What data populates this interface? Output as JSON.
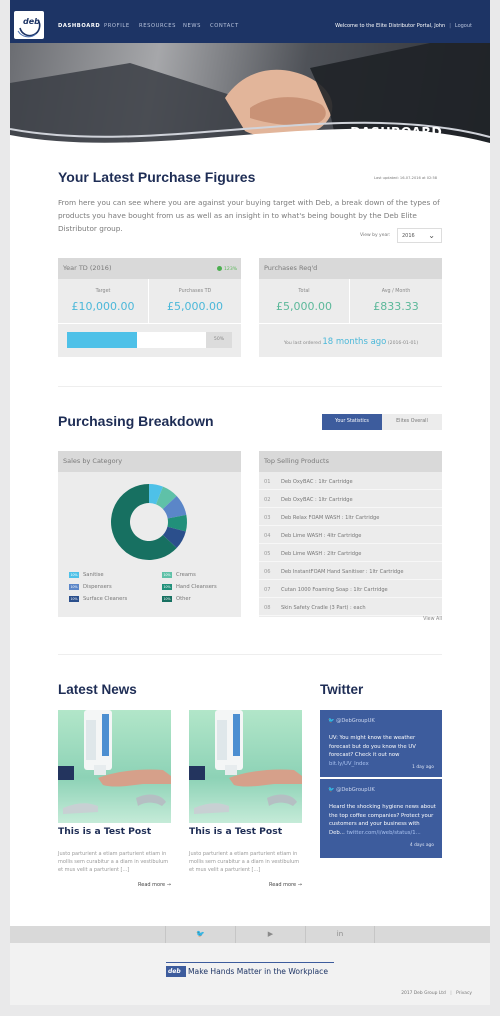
{
  "nav": {
    "logo_text": "deb",
    "items": [
      {
        "label": "DASHBOARD"
      },
      {
        "label": "PROFILE"
      },
      {
        "label": "RESOURCES"
      },
      {
        "label": "NEWS"
      },
      {
        "label": "CONTACT"
      }
    ],
    "welcome": "Welcome to the Elite Distributor Portal, John",
    "separator": "|",
    "logout": "Logout"
  },
  "hero": {
    "title": "DASHBOARD"
  },
  "purchase": {
    "title": "Your Latest Purchase Figures",
    "updated": "Last updated: 16-07-2016 at 02:58",
    "intro": "From here you can see where you are against your buying target with Deb, a break down of the types of products you have bought from us as well as an insight in to what's being bought by the Deb Elite Distributor group.",
    "view_by_label": "View by year:",
    "year_selected": "2016",
    "ytd": {
      "heading": "Year TD (2016)",
      "growth": "123%",
      "target_label": "Target",
      "target_value": "£10,000.00",
      "purchases_label": "Purchases TD",
      "purchases_value": "£5,000.00",
      "progress_percent": 50,
      "progress_label": "50%"
    },
    "req": {
      "heading": "Purchases Req'd",
      "total_label": "Total",
      "total_value": "£5,000.00",
      "avg_label": "Avg / Month",
      "avg_value": "£833.33",
      "last_ordered_prefix": "You last ordered",
      "last_ordered_value": "18 months ago",
      "last_ordered_date": "(2016-01-01)"
    }
  },
  "breakdown": {
    "title": "Purchasing Breakdown",
    "toggle_active": "Your Statistics",
    "toggle_inactive": "Elites Overall",
    "sales_heading": "Sales by Category",
    "legend": [
      {
        "pct": "10%",
        "label": "Sanitise",
        "color": "#4ec1e8"
      },
      {
        "pct": "10%",
        "label": "Creams",
        "color": "#5fc1a8"
      },
      {
        "pct": "10%",
        "label": "Dispensers",
        "color": "#5b86c8"
      },
      {
        "pct": "10%",
        "label": "Hand Cleansers",
        "color": "#21907a"
      },
      {
        "pct": "10%",
        "label": "Surface Cleaners",
        "color": "#2b4f8c"
      },
      {
        "pct": "10%",
        "label": "Other",
        "color": "#177061"
      }
    ],
    "donut_share": [
      0.06,
      0.07,
      0.09,
      0.07,
      0.08,
      0.63
    ],
    "products_heading": "Top Selling Products",
    "products": [
      {
        "num": "01",
        "name": "Deb OxyBAC : 1ltr Cartridge"
      },
      {
        "num": "02",
        "name": "Deb OxyBAC : 1ltr Cartridge"
      },
      {
        "num": "03",
        "name": "Deb Relax FOAM WASH : 1ltr Cartridge"
      },
      {
        "num": "04",
        "name": "Deb Lime WASH : 4ltr Cartridge"
      },
      {
        "num": "05",
        "name": "Deb Lime WASH : 2ltr Cartridge"
      },
      {
        "num": "06",
        "name": "Deb InstantFOAM Hand Sanitiser : 1ltr Cartridge"
      },
      {
        "num": "07",
        "name": "Cutan 1000 Foaming Soap : 1ltr Cartridge"
      },
      {
        "num": "08",
        "name": "Skin Safety Cradle (3 Part) : each"
      }
    ],
    "view_all": "View All"
  },
  "news": {
    "title": "Latest News",
    "posts": [
      {
        "title": "This is a Test Post",
        "text": "Justo parturient a etiam parturient etiam in mollis sem curabitur a a diam in vestibulum et mus velit a parturient [...]",
        "read_more": "Read more →"
      },
      {
        "title": "This is a Test Post",
        "text": "Justo parturient a etiam parturient etiam in mollis sem curabitur a a diam in vestibulum et mus velit a parturient [...]",
        "read_more": "Read more →"
      }
    ]
  },
  "twitter": {
    "title": "Twitter",
    "tweets": [
      {
        "handle": "@DebGroupUK",
        "text": "UV: You might know the weather forecast but do you know the UV forecast? Check it out now",
        "link": "bit.ly/UV_Index",
        "when": "1 day ago"
      },
      {
        "handle": "@DebGroupUK",
        "text": "Heard the shocking hygiene news about the top coffee companies? Protect your customers and your business with Deb...",
        "link": "twitter.com/i/web/status/1...",
        "when": "4 days ago"
      }
    ]
  },
  "footer": {
    "social": [
      "twitter-icon",
      "youtube-icon",
      "linkedin-icon"
    ],
    "social_glyphs": [
      "🐦",
      "▶",
      "in"
    ],
    "brand_mark": "deb",
    "tagline": "Make Hands Matter in the Workplace",
    "copyright": "2017 Deb Group Ltd",
    "separator": "|",
    "privacy": "Privacy"
  }
}
